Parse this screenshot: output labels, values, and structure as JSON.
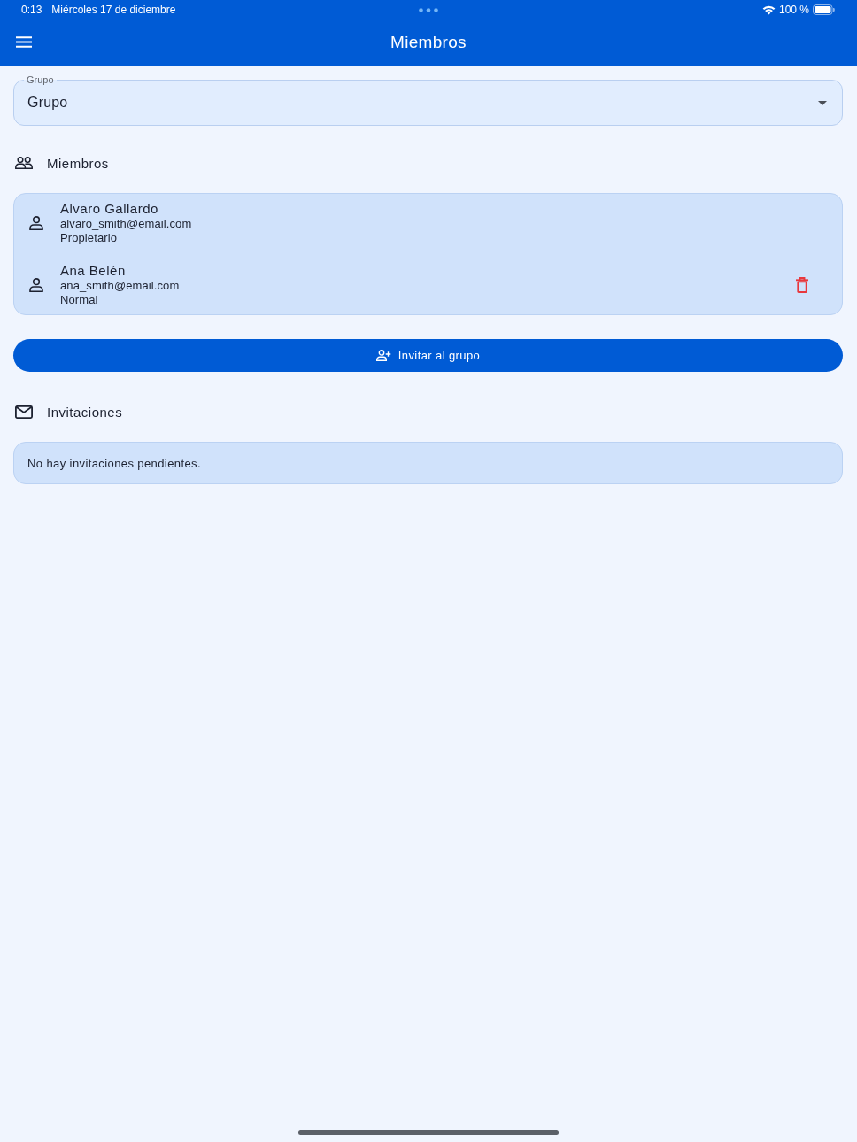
{
  "status_bar": {
    "time": "0:13",
    "date": "Miércoles 17 de diciembre",
    "battery": "100 %"
  },
  "app_bar": {
    "title": "Miembros"
  },
  "group_field": {
    "label": "Grupo",
    "value": "Grupo"
  },
  "members_section": {
    "title": "Miembros",
    "members": [
      {
        "name": "Alvaro Gallardo",
        "email": "alvaro_smith@email.com",
        "role": "Propietario",
        "removable": false
      },
      {
        "name": "Ana Belén",
        "email": "ana_smith@email.com",
        "role": "Normal",
        "removable": true
      }
    ]
  },
  "invite_button": {
    "label": "Invitar al grupo"
  },
  "invitations_section": {
    "title": "Invitaciones",
    "empty_message": "No hay invitaciones pendientes."
  }
}
